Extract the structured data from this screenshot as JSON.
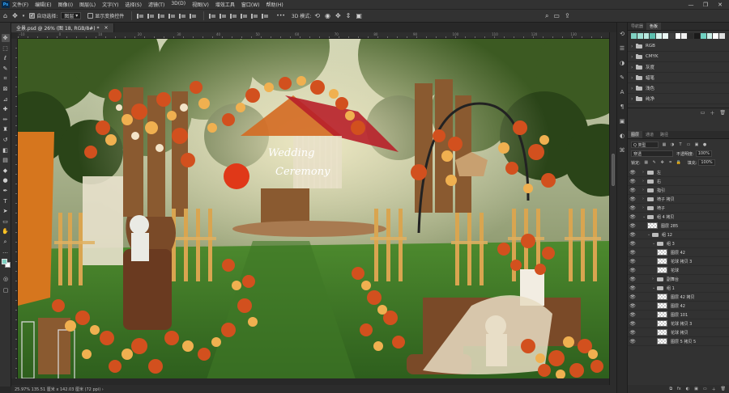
{
  "app": {
    "logo": "Ps"
  },
  "menu": [
    "文件(F)",
    "编辑(E)",
    "图像(I)",
    "图层(L)",
    "文字(Y)",
    "选择(S)",
    "滤镜(T)",
    "3D(D)",
    "视图(V)",
    "增效工具",
    "窗口(W)",
    "帮助(H)"
  ],
  "window_controls": [
    "—",
    "❐",
    "✕"
  ],
  "options": {
    "auto_select_label": "自动选择:",
    "auto_select_value": "图层",
    "transform_label": "显示变换控件",
    "more": "•••",
    "mode_3d": "3D 模式:"
  },
  "document": {
    "tab": "全景.psd @ 26% (图 18, RGB/8#) *",
    "close": "×"
  },
  "ruler_numbers": [
    "-10",
    "0",
    "10",
    "20",
    "30",
    "40",
    "50",
    "60",
    "70",
    "80",
    "90",
    "100",
    "110",
    "120",
    "130"
  ],
  "artwork": {
    "sign_line1": "Wedding",
    "sign_line2": "Ceremony"
  },
  "status": "25.97%   135.51 厘米 x 142.03 厘米 (72 ppi)   ›",
  "colors": {
    "foreground": "#7fd1c2",
    "background": "#ffffff",
    "accent_ui": "#323232"
  },
  "swatches_panel": {
    "tabs": [
      "导航器",
      "色板"
    ],
    "swatches": [
      "#7fd1c2",
      "#9fe0d3",
      "#b8e8de",
      "#5bbfae",
      "#d8f2ec",
      "#eaf7f4",
      "#3e3e3e",
      "#ffffff",
      "#f0f0f0",
      "#2b2b2b",
      "#1a1a1a",
      "#6fd0c0",
      "#c9ece5",
      "#ffffff",
      "#dfe0e0"
    ],
    "folders": [
      "RGB",
      "CMYK",
      "灰度",
      "蜡笔",
      "浅色",
      "纯净"
    ]
  },
  "layers_panel": {
    "tabs": [
      "图层",
      "通道",
      "路径"
    ],
    "filter": "Q 类型",
    "blend_mode": "穿透",
    "opacity_label": "不透明度:",
    "opacity_value": "100%",
    "lock_label": "锁定:",
    "fill_label": "填充:",
    "fill_value": "100%",
    "layers": [
      {
        "name": "左",
        "type": "folder",
        "indent": 1
      },
      {
        "name": "右",
        "type": "folder",
        "indent": 1
      },
      {
        "name": "指引",
        "type": "folder",
        "indent": 1
      },
      {
        "name": "椅子 拷贝",
        "type": "folder",
        "indent": 1
      },
      {
        "name": "椅子",
        "type": "folder",
        "indent": 1
      },
      {
        "name": "组 4 拷贝",
        "type": "folder",
        "indent": 1,
        "open": true
      },
      {
        "name": "图层 285",
        "type": "layer",
        "indent": 2
      },
      {
        "name": "组 12",
        "type": "folder",
        "indent": 2,
        "open": true
      },
      {
        "name": "组 3",
        "type": "folder",
        "indent": 3,
        "open": true
      },
      {
        "name": "图层 42",
        "type": "layer",
        "indent": 4
      },
      {
        "name": "花球 拷贝 3",
        "type": "layer",
        "indent": 4
      },
      {
        "name": "花球",
        "type": "layer",
        "indent": 4
      },
      {
        "name": "副舞台",
        "type": "folder",
        "indent": 3
      },
      {
        "name": "组 1",
        "type": "folder",
        "indent": 3,
        "open": true
      },
      {
        "name": "图层 42 拷贝",
        "type": "layer",
        "indent": 4
      },
      {
        "name": "图层 42",
        "type": "layer",
        "indent": 4
      },
      {
        "name": "图层 101",
        "type": "layer",
        "indent": 4
      },
      {
        "name": "花球 拷贝 3",
        "type": "layer",
        "indent": 4
      },
      {
        "name": "花球 拷贝",
        "type": "layer",
        "indent": 4
      },
      {
        "name": "图层 5 拷贝 5",
        "type": "layer",
        "indent": 4
      }
    ],
    "footer_icons": [
      "fx",
      "◐",
      "▣",
      "▭",
      "＋",
      "🗑"
    ]
  }
}
